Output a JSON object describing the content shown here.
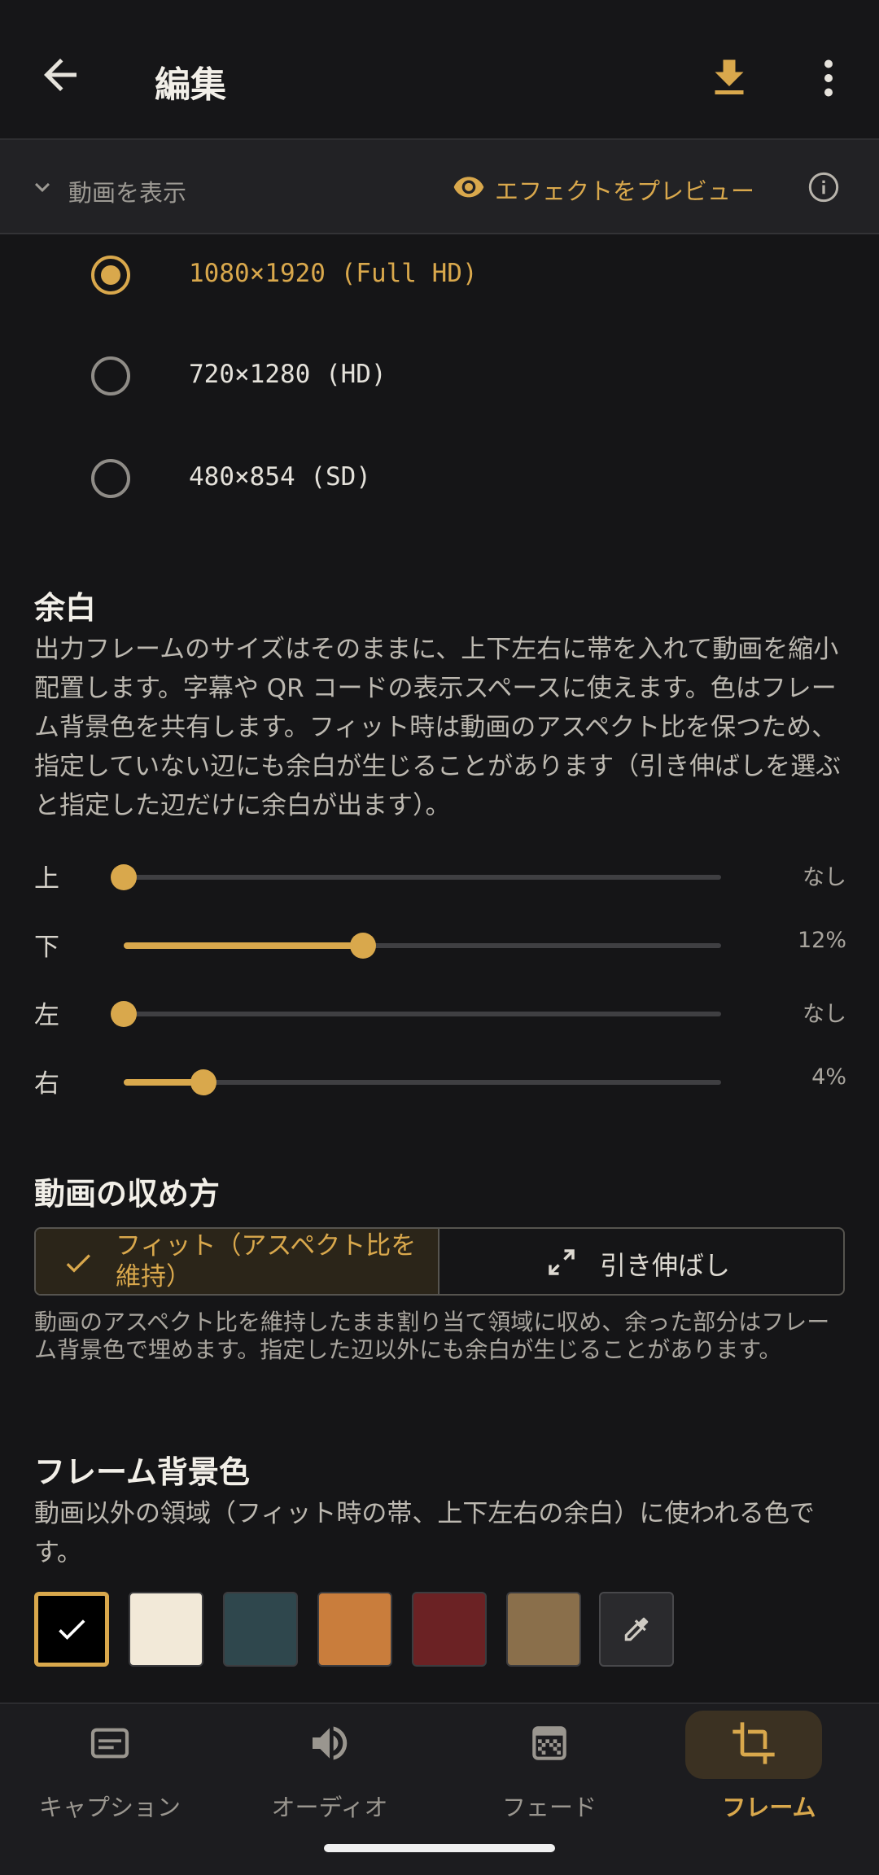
{
  "app_bar": {
    "title": "編集"
  },
  "preview_strip": {
    "show_video_label": "動画を表示",
    "preview_effect_label": "エフェクトをプレビュー"
  },
  "resolution": {
    "options": [
      {
        "label": "1080×1920 (Full HD)",
        "selected": true
      },
      {
        "label": "720×1280 (HD)",
        "selected": false
      },
      {
        "label": "480×854 (SD)",
        "selected": false
      }
    ]
  },
  "margin": {
    "title": "余白",
    "description": "出力フレームのサイズはそのままに、上下左右に帯を入れて動画を縮小配置します。字幕や QR コードの表示スペースに使えます。色はフレーム背景色を共有します。フィット時は動画のアスペクト比を保つため、指定していない辺にも余白が生じることがあります（引き伸ばしを選ぶと指定した辺だけに余白が出ます）。",
    "sliders": [
      {
        "label": "上",
        "value_text": "なし",
        "fraction": 0.0
      },
      {
        "label": "下",
        "value_text": "12%",
        "fraction": 0.4
      },
      {
        "label": "左",
        "value_text": "なし",
        "fraction": 0.0
      },
      {
        "label": "右",
        "value_text": "4%",
        "fraction": 0.133
      }
    ]
  },
  "fit_mode": {
    "title": "動画の収め方",
    "fit_label": "フィット（アスペクト比を維持）",
    "stretch_label": "引き伸ばし",
    "selected": "fit",
    "description": "動画のアスペクト比を維持したまま割り当て領域に収め、余った部分はフレーム背景色で埋めます。指定した辺以外にも余白が生じることがあります。"
  },
  "frame_bg": {
    "title": "フレーム背景色",
    "description": "動画以外の領域（フィット時の帯、上下左右の余白）に使われる色です。",
    "swatches": [
      {
        "color": "#000000",
        "selected": true
      },
      {
        "color": "#f2e9d8",
        "selected": false
      },
      {
        "color": "#2f474d",
        "selected": false
      },
      {
        "color": "#c97d3c",
        "selected": false
      },
      {
        "color": "#6b2224",
        "selected": false
      },
      {
        "color": "#8a6f4b",
        "selected": false
      }
    ],
    "custom_icon": "eyedropper-icon"
  },
  "bottom_nav": {
    "items": [
      {
        "label": "キャプション",
        "icon": "caption-icon",
        "active": false
      },
      {
        "label": "オーディオ",
        "icon": "speaker-icon",
        "active": false
      },
      {
        "label": "フェード",
        "icon": "fade-icon",
        "active": false
      },
      {
        "label": "フレーム",
        "icon": "crop-icon",
        "active": true
      }
    ]
  },
  "colors": {
    "accent": "#d9a84c",
    "background": "#151517"
  }
}
